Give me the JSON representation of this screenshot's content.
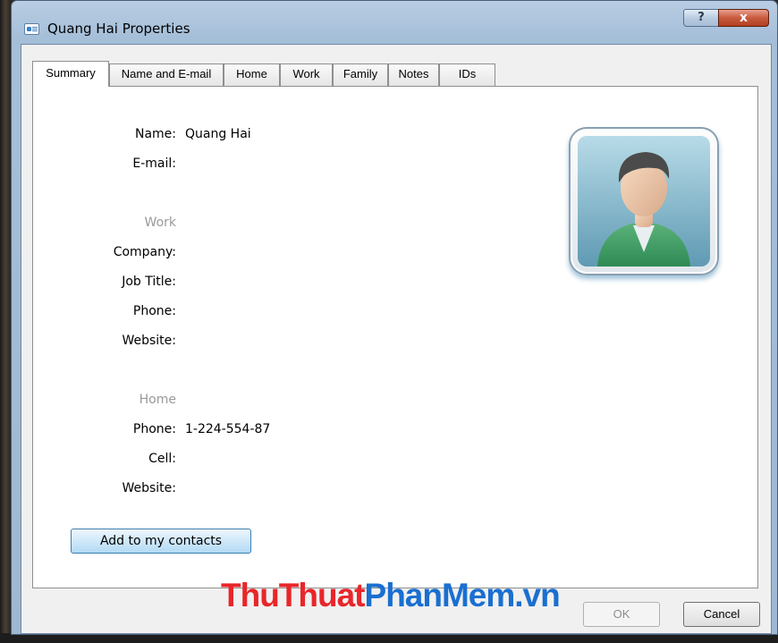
{
  "window": {
    "title": "Quang Hai Properties",
    "help_label": "?",
    "close_label": "x"
  },
  "tabs": [
    "Summary",
    "Name and E-mail",
    "Home",
    "Work",
    "Family",
    "Notes",
    "IDs"
  ],
  "active_tab": "Summary",
  "contact": {
    "name_label": "Name:",
    "name_value": "Quang Hai",
    "email_label": "E-mail:",
    "email_value": ""
  },
  "work": {
    "section_label": "Work",
    "company_label": "Company:",
    "job_title_label": "Job Title:",
    "phone_label": "Phone:",
    "website_label": "Website:"
  },
  "home": {
    "section_label": "Home",
    "phone_label": "Phone:",
    "phone_value": "1-224-554-87",
    "cell_label": "Cell:",
    "website_label": "Website:"
  },
  "buttons": {
    "add_to_contacts": "Add to my contacts",
    "ok": "OK",
    "cancel": "Cancel"
  },
  "watermark": {
    "part1": "ThuThuat",
    "part2": "PhanMem.vn"
  },
  "icons": {
    "title": "contact-card-icon",
    "avatar": "default-user-avatar-icon"
  }
}
